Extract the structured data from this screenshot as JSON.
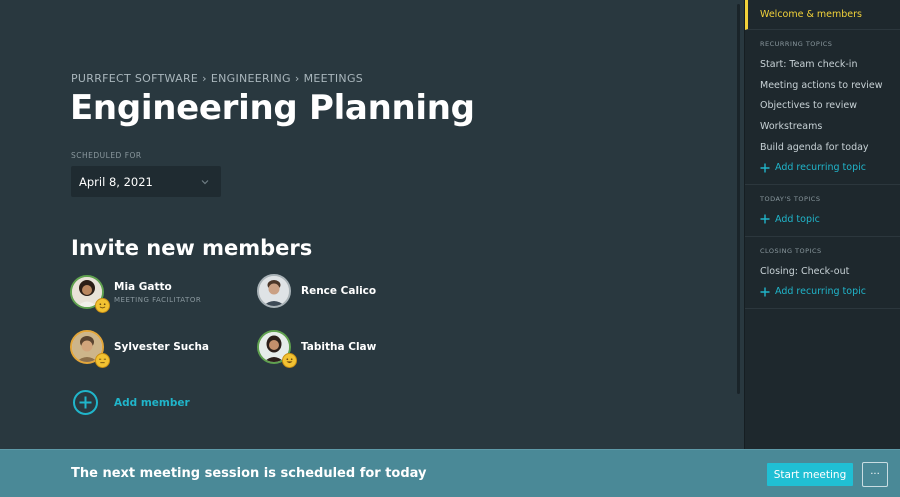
{
  "breadcrumb": [
    "PURRFECT SOFTWARE",
    "›",
    "ENGINEERING",
    "›",
    "MEETINGS"
  ],
  "title": "Engineering Planning",
  "scheduled": {
    "label": "SCHEDULED FOR",
    "date": "April 8, 2021"
  },
  "invite": {
    "title": "Invite new members",
    "members": [
      {
        "name": "Mia Gatto",
        "role": "MEETING FACILITATOR"
      },
      {
        "name": "Rence Calico",
        "role": ""
      },
      {
        "name": "Sylvester Sucha",
        "role": ""
      },
      {
        "name": "Tabitha Claw",
        "role": ""
      }
    ],
    "add_label": "Add member"
  },
  "bottom": {
    "message": "The next meeting session is scheduled for today",
    "start_label": "Start meeting",
    "more_label": "···"
  },
  "sidebar": {
    "active": "Welcome & members",
    "sections": [
      {
        "heading": "RECURRING TOPICS",
        "items": [
          "Start: Team check-in",
          "Meeting actions to review",
          "Objectives to review",
          "Workstreams",
          "Build agenda for today"
        ],
        "add_label": "Add recurring topic"
      },
      {
        "heading": "TODAY'S TOPICS",
        "items": [],
        "add_label": "Add topic"
      },
      {
        "heading": "CLOSING TOPICS",
        "items": [
          "Closing: Check-out"
        ],
        "add_label": "Add recurring topic"
      }
    ]
  },
  "colors": {
    "accent": "#20b5ca",
    "active": "#f2d23a",
    "background": "#29383f",
    "sidebar": "#1e282d",
    "bottom_bar": "#4a8997"
  },
  "icons": {
    "date_select": "chevron-down-icon",
    "add": "plus-icon",
    "add_member": "plus-circle-icon",
    "status": "emoji-icon"
  }
}
